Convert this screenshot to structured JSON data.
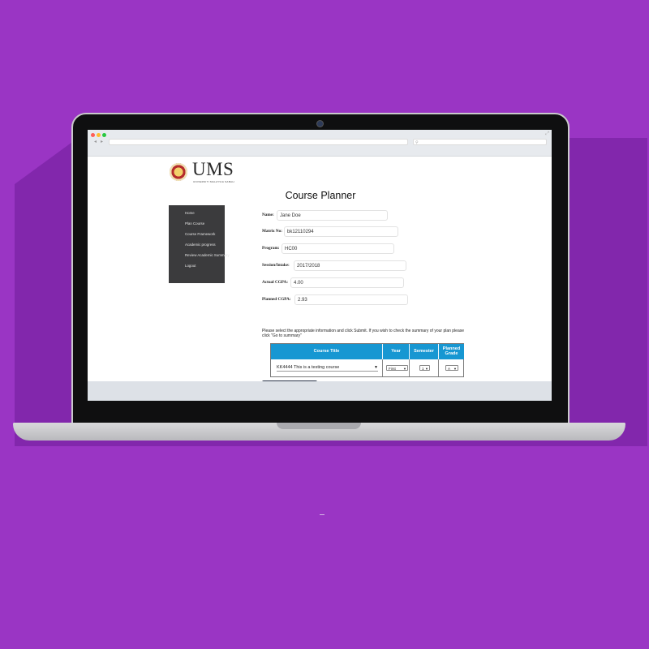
{
  "page": {
    "background_color": "#9a35c4"
  },
  "browser": {
    "url": "",
    "search_placeholder": "",
    "icons": [
      "back-icon",
      "forward-icon",
      "search-icon",
      "expand-icon"
    ]
  },
  "logo": {
    "text": "UMS",
    "subtext": "UNIVERSITI MALAYSIA SABAH"
  },
  "title": "Course Planner",
  "sidebar": {
    "items": [
      {
        "label": "Home"
      },
      {
        "label": "Plan Course"
      },
      {
        "label": "Course Framework"
      },
      {
        "label": "Academic progress"
      },
      {
        "label": "Review Academic Summary"
      },
      {
        "label": "Logout"
      }
    ]
  },
  "form": {
    "name": {
      "label": "Name:",
      "value": "Jane  Doe"
    },
    "matrix": {
      "label": "Matrix No:",
      "value": "bk12110294"
    },
    "program": {
      "label": "Program:",
      "value": "HC00"
    },
    "session": {
      "label": "Session/Intake:",
      "value": "2017/2018"
    },
    "actual_cgpa": {
      "label": "Actual CGPA:",
      "value": "4.00"
    },
    "planned_cgpa": {
      "label": "Planned CGPA:",
      "value": "2.93"
    }
  },
  "instructions": "Please select the appropriate information and click Submit. If you wish to check the summary of your plan please click \"Go to summary\"",
  "table": {
    "headers": {
      "course_title": "Course Title",
      "year": "Year",
      "semester": "Semester",
      "planned_grade_line1": "Planned",
      "planned_grade_line2": "Grade"
    },
    "row": {
      "course": "KK4444 This is a testing course",
      "year": "First",
      "semester": "1",
      "grade": "A"
    },
    "header_color": "#1797d2"
  }
}
